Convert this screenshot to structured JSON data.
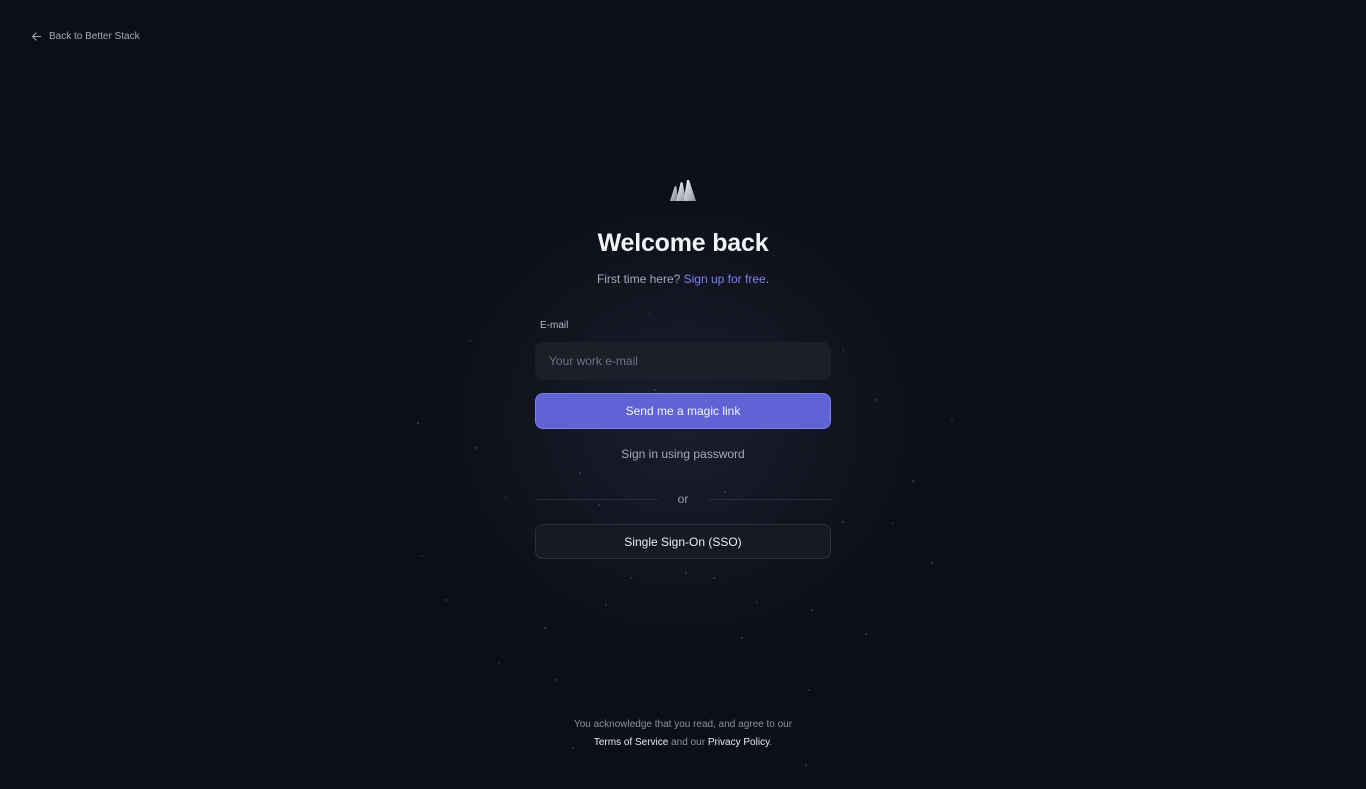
{
  "nav": {
    "back_label": "Back to Better Stack",
    "back_icon": "arrow-left-icon"
  },
  "header": {
    "logo_icon": "better-stack-logo-icon",
    "title": "Welcome back",
    "subtitle_prefix": "First time here?",
    "signup_link": "Sign up for free",
    "subtitle_suffix": "."
  },
  "form": {
    "email_label": "E-mail",
    "email_placeholder": "Your work e-mail",
    "email_value": "",
    "magic_link_button": "Send me a magic link",
    "password_link": "Sign in using password",
    "divider_text": "or",
    "sso_button": "Single Sign-On (SSO)"
  },
  "footer": {
    "line1": "You acknowledge that you read, and agree to our",
    "terms_link": "Terms of Service",
    "and_text": "and our",
    "privacy_link": "Privacy Policy",
    "end_text": "."
  },
  "colors": {
    "background": "#0d0f18",
    "accent": "#5f63d4",
    "link": "#7b80f0"
  }
}
